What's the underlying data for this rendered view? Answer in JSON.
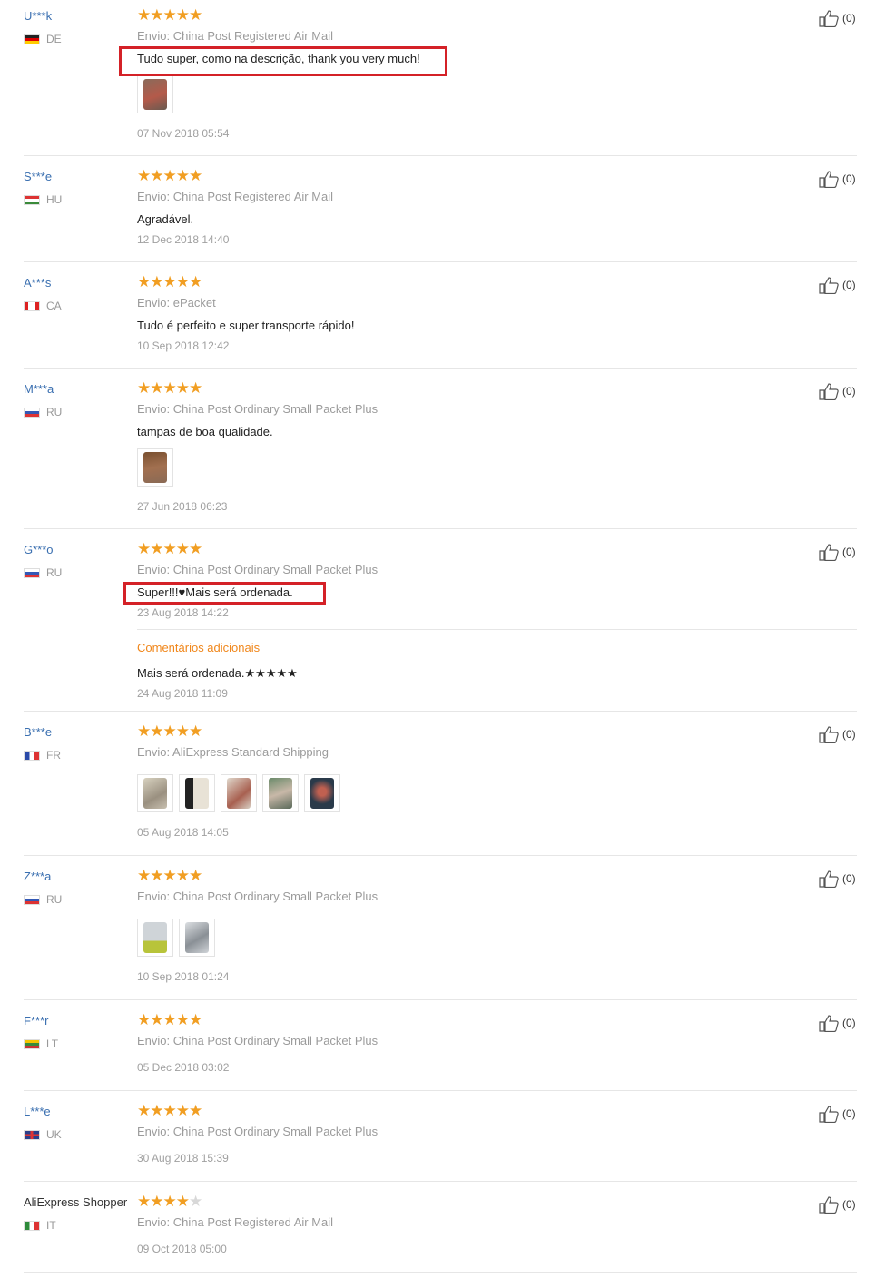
{
  "reviews": [
    {
      "user": "U***k",
      "country": "DE",
      "flag": "de",
      "stars": 5,
      "shipping": "Envio: China Post Registered Air Mail",
      "text": "Tudo super, como na descrição, thank you very much!",
      "date": "07 Nov 2018 05:54",
      "helpful": "(0)"
    },
    {
      "user": "S***e",
      "country": "HU",
      "flag": "hu",
      "stars": 5,
      "shipping": "Envio: China Post Registered Air Mail",
      "text": "Agradável.",
      "date": "12 Dec 2018 14:40",
      "helpful": "(0)"
    },
    {
      "user": "A***s",
      "country": "CA",
      "flag": "ca",
      "stars": 5,
      "shipping": "Envio: ePacket",
      "text": "Tudo é perfeito e super transporte rápido!",
      "date": "10 Sep 2018 12:42",
      "helpful": "(0)"
    },
    {
      "user": "M***a",
      "country": "RU",
      "flag": "ru",
      "stars": 5,
      "shipping": "Envio: China Post Ordinary Small Packet Plus",
      "text": "tampas de boa qualidade.",
      "date": "27 Jun 2018 06:23",
      "helpful": "(0)"
    },
    {
      "user": "G***o",
      "country": "RU",
      "flag": "ru",
      "stars": 5,
      "shipping": "Envio: China Post Ordinary Small Packet Plus",
      "text": "Super!!!♥Mais será ordenada.",
      "date": "23 Aug 2018 14:22",
      "additional_label": "Comentários adicionais",
      "additional_text": "Mais será ordenada.★★★★★",
      "additional_date": "24 Aug 2018 11:09",
      "helpful": "(0)"
    },
    {
      "user": "B***e",
      "country": "FR",
      "flag": "fr",
      "stars": 5,
      "shipping": "Envio: AliExpress Standard Shipping",
      "date": "05 Aug 2018 14:05",
      "helpful": "(0)"
    },
    {
      "user": "Z***a",
      "country": "RU",
      "flag": "ru",
      "stars": 5,
      "shipping": "Envio: China Post Ordinary Small Packet Plus",
      "date": "10 Sep 2018 01:24",
      "helpful": "(0)"
    },
    {
      "user": "F***r",
      "country": "LT",
      "flag": "lt",
      "stars": 5,
      "shipping": "Envio: China Post Ordinary Small Packet Plus",
      "date": "05 Dec 2018 03:02",
      "helpful": "(0)"
    },
    {
      "user": "L***e",
      "country": "UK",
      "flag": "uk",
      "stars": 5,
      "shipping": "Envio: China Post Ordinary Small Packet Plus",
      "date": "30 Aug 2018 15:39",
      "helpful": "(0)"
    },
    {
      "user": "AliExpress Shopper",
      "country": "IT",
      "flag": "it",
      "stars": 4,
      "shipping": "Envio: China Post Registered Air Mail",
      "date": "09 Oct 2018 05:00",
      "helpful": "(0)"
    }
  ],
  "colors": {
    "accent_star": "#f19e22",
    "highlight_box": "#d42127",
    "username_link": "#3a6fb0"
  },
  "icons": {
    "rating": "star-icon",
    "helpful": "thumbs-up-icon",
    "review_photo": "photo-thumbnail"
  }
}
